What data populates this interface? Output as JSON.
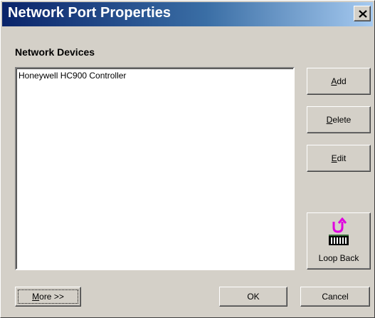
{
  "window": {
    "title": "Network Port Properties"
  },
  "section": {
    "label": "Network Devices"
  },
  "devices": {
    "items": [
      "Honeywell HC900 Controller"
    ]
  },
  "buttons": {
    "add": {
      "mnemonic": "A",
      "rest": "dd"
    },
    "delete": {
      "mnemonic": "D",
      "rest": "elete"
    },
    "edit": {
      "mnemonic": "E",
      "rest": "dit"
    },
    "loop_back": "Loop Back",
    "more": {
      "mnemonic": "M",
      "rest": "ore >>"
    },
    "ok": "OK",
    "cancel": "Cancel"
  },
  "icons": {
    "close": "close-icon",
    "loop_back": "loop-back-icon"
  },
  "colors": {
    "titlebar_start": "#0a246a",
    "titlebar_end": "#a6caf0",
    "loop_arrow": "#e000e0"
  }
}
